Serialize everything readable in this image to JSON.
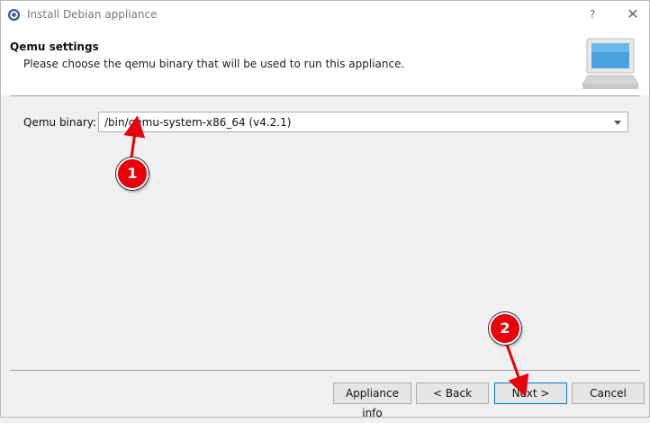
{
  "window": {
    "title": "Install Debian appliance",
    "help_glyph": "?",
    "close_glyph": "✕"
  },
  "header": {
    "title": "Qemu settings",
    "subtitle": "Please choose the qemu binary that will be used to run this appliance.",
    "graphic": "computer-icon"
  },
  "form": {
    "qemu_label": "Qemu binary:",
    "qemu_value": "/bin/qemu-system-x86_64 (v4.2.1)"
  },
  "buttons": {
    "appliance_info": "Appliance info",
    "back": "< Back",
    "next": "Next >",
    "cancel": "Cancel"
  },
  "annotations": [
    {
      "label": "1",
      "color": "#e8000b"
    },
    {
      "label": "2",
      "color": "#e8000b"
    }
  ],
  "colors": {
    "accent": "#0078d7",
    "annotation": "#e8000b"
  }
}
